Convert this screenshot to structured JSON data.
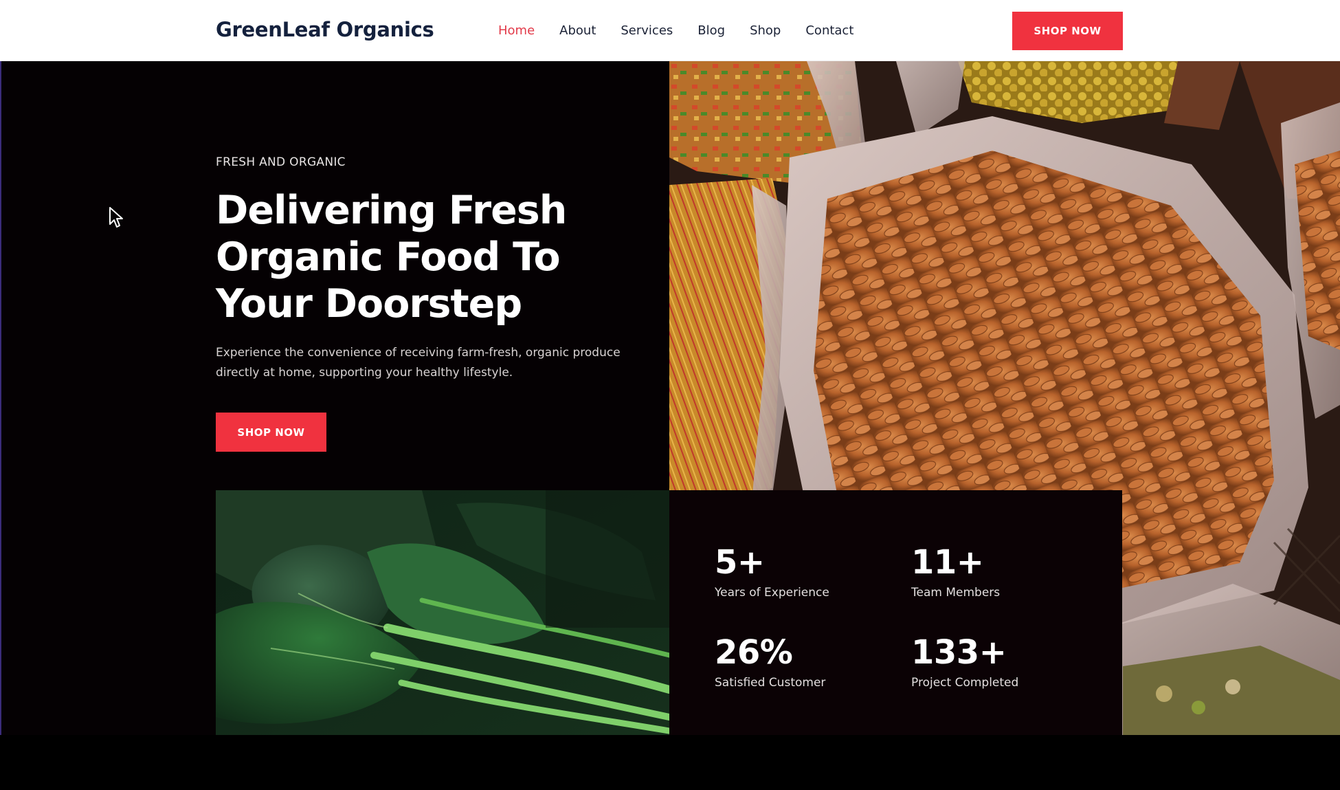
{
  "nav": {
    "logo": "GreenLeaf Organics",
    "links": [
      "Home",
      "About",
      "Services",
      "Blog",
      "Shop",
      "Contact"
    ],
    "active_index": 0,
    "cta": "SHOP NOW"
  },
  "hero": {
    "eyebrow": "FRESH AND ORGANIC",
    "title_line1": "Delivering Fresh",
    "title_line2": "Organic Food To",
    "title_line3": "Your Doorstep",
    "description_line1": "Experience the convenience of receiving farm-fresh, organic produce",
    "description_line2": "directly at home, supporting your healthy lifestyle.",
    "cta": "SHOP NOW"
  },
  "stats": [
    {
      "value": "5+",
      "label": "Years of Experience"
    },
    {
      "value": "11+",
      "label": "Team Members"
    },
    {
      "value": "26%",
      "label": "Satisfied Customer"
    },
    {
      "value": "133+",
      "label": "Project Completed"
    }
  ],
  "images": {
    "nuts": "almond-sacks-photo",
    "leaves": "spinach-leaves-photo"
  },
  "colors": {
    "accent": "#f0323f",
    "active_link": "#e23b4a",
    "hero_bg": "#050103",
    "logo": "#14213d"
  }
}
